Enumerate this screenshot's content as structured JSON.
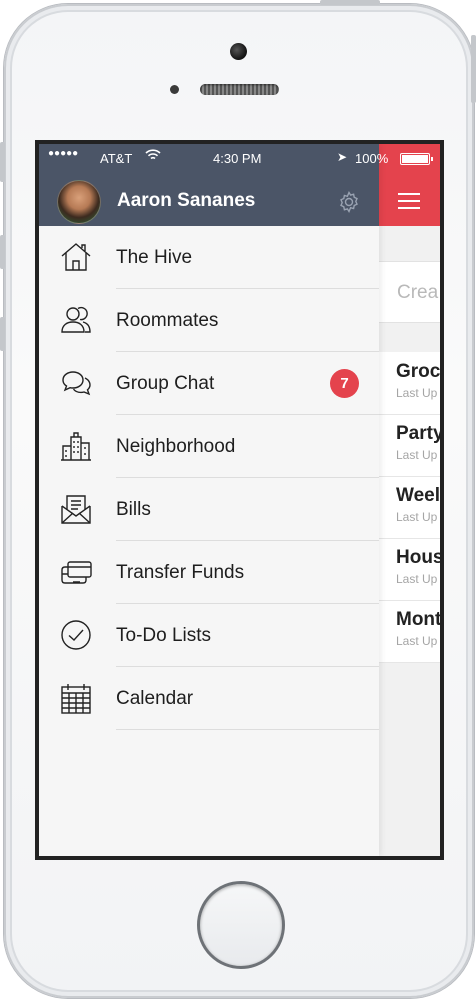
{
  "status_bar": {
    "signal": "●●●●●",
    "carrier": "AT&T",
    "time": "4:30 PM",
    "battery": "100%"
  },
  "drawer": {
    "user_name": "Aaron Sananes",
    "menu": [
      {
        "label": "The Hive",
        "icon": "house-icon"
      },
      {
        "label": "Roommates",
        "icon": "people-icon"
      },
      {
        "label": "Group Chat",
        "icon": "chat-bubbles-icon",
        "badge": "7"
      },
      {
        "label": "Neighborhood",
        "icon": "buildings-icon"
      },
      {
        "label": "Bills",
        "icon": "envelope-icon"
      },
      {
        "label": "Transfer Funds",
        "icon": "cards-icon"
      },
      {
        "label": "To-Do Lists",
        "icon": "checkmark-circle-icon"
      },
      {
        "label": "Calendar",
        "icon": "calendar-icon"
      }
    ]
  },
  "main": {
    "create_placeholder": "Crea",
    "lists": [
      {
        "title": "Groc",
        "subtitle": "Last Up"
      },
      {
        "title": "Party",
        "subtitle": "Last Up"
      },
      {
        "title": "Weel",
        "subtitle": "Last Up"
      },
      {
        "title": "Hous",
        "subtitle": "Last Up"
      },
      {
        "title": "Mont",
        "subtitle": "Last Up"
      }
    ]
  },
  "colors": {
    "header": "#4b5567",
    "accent": "#e4434d",
    "drawer_bg": "#f6f6f6"
  }
}
